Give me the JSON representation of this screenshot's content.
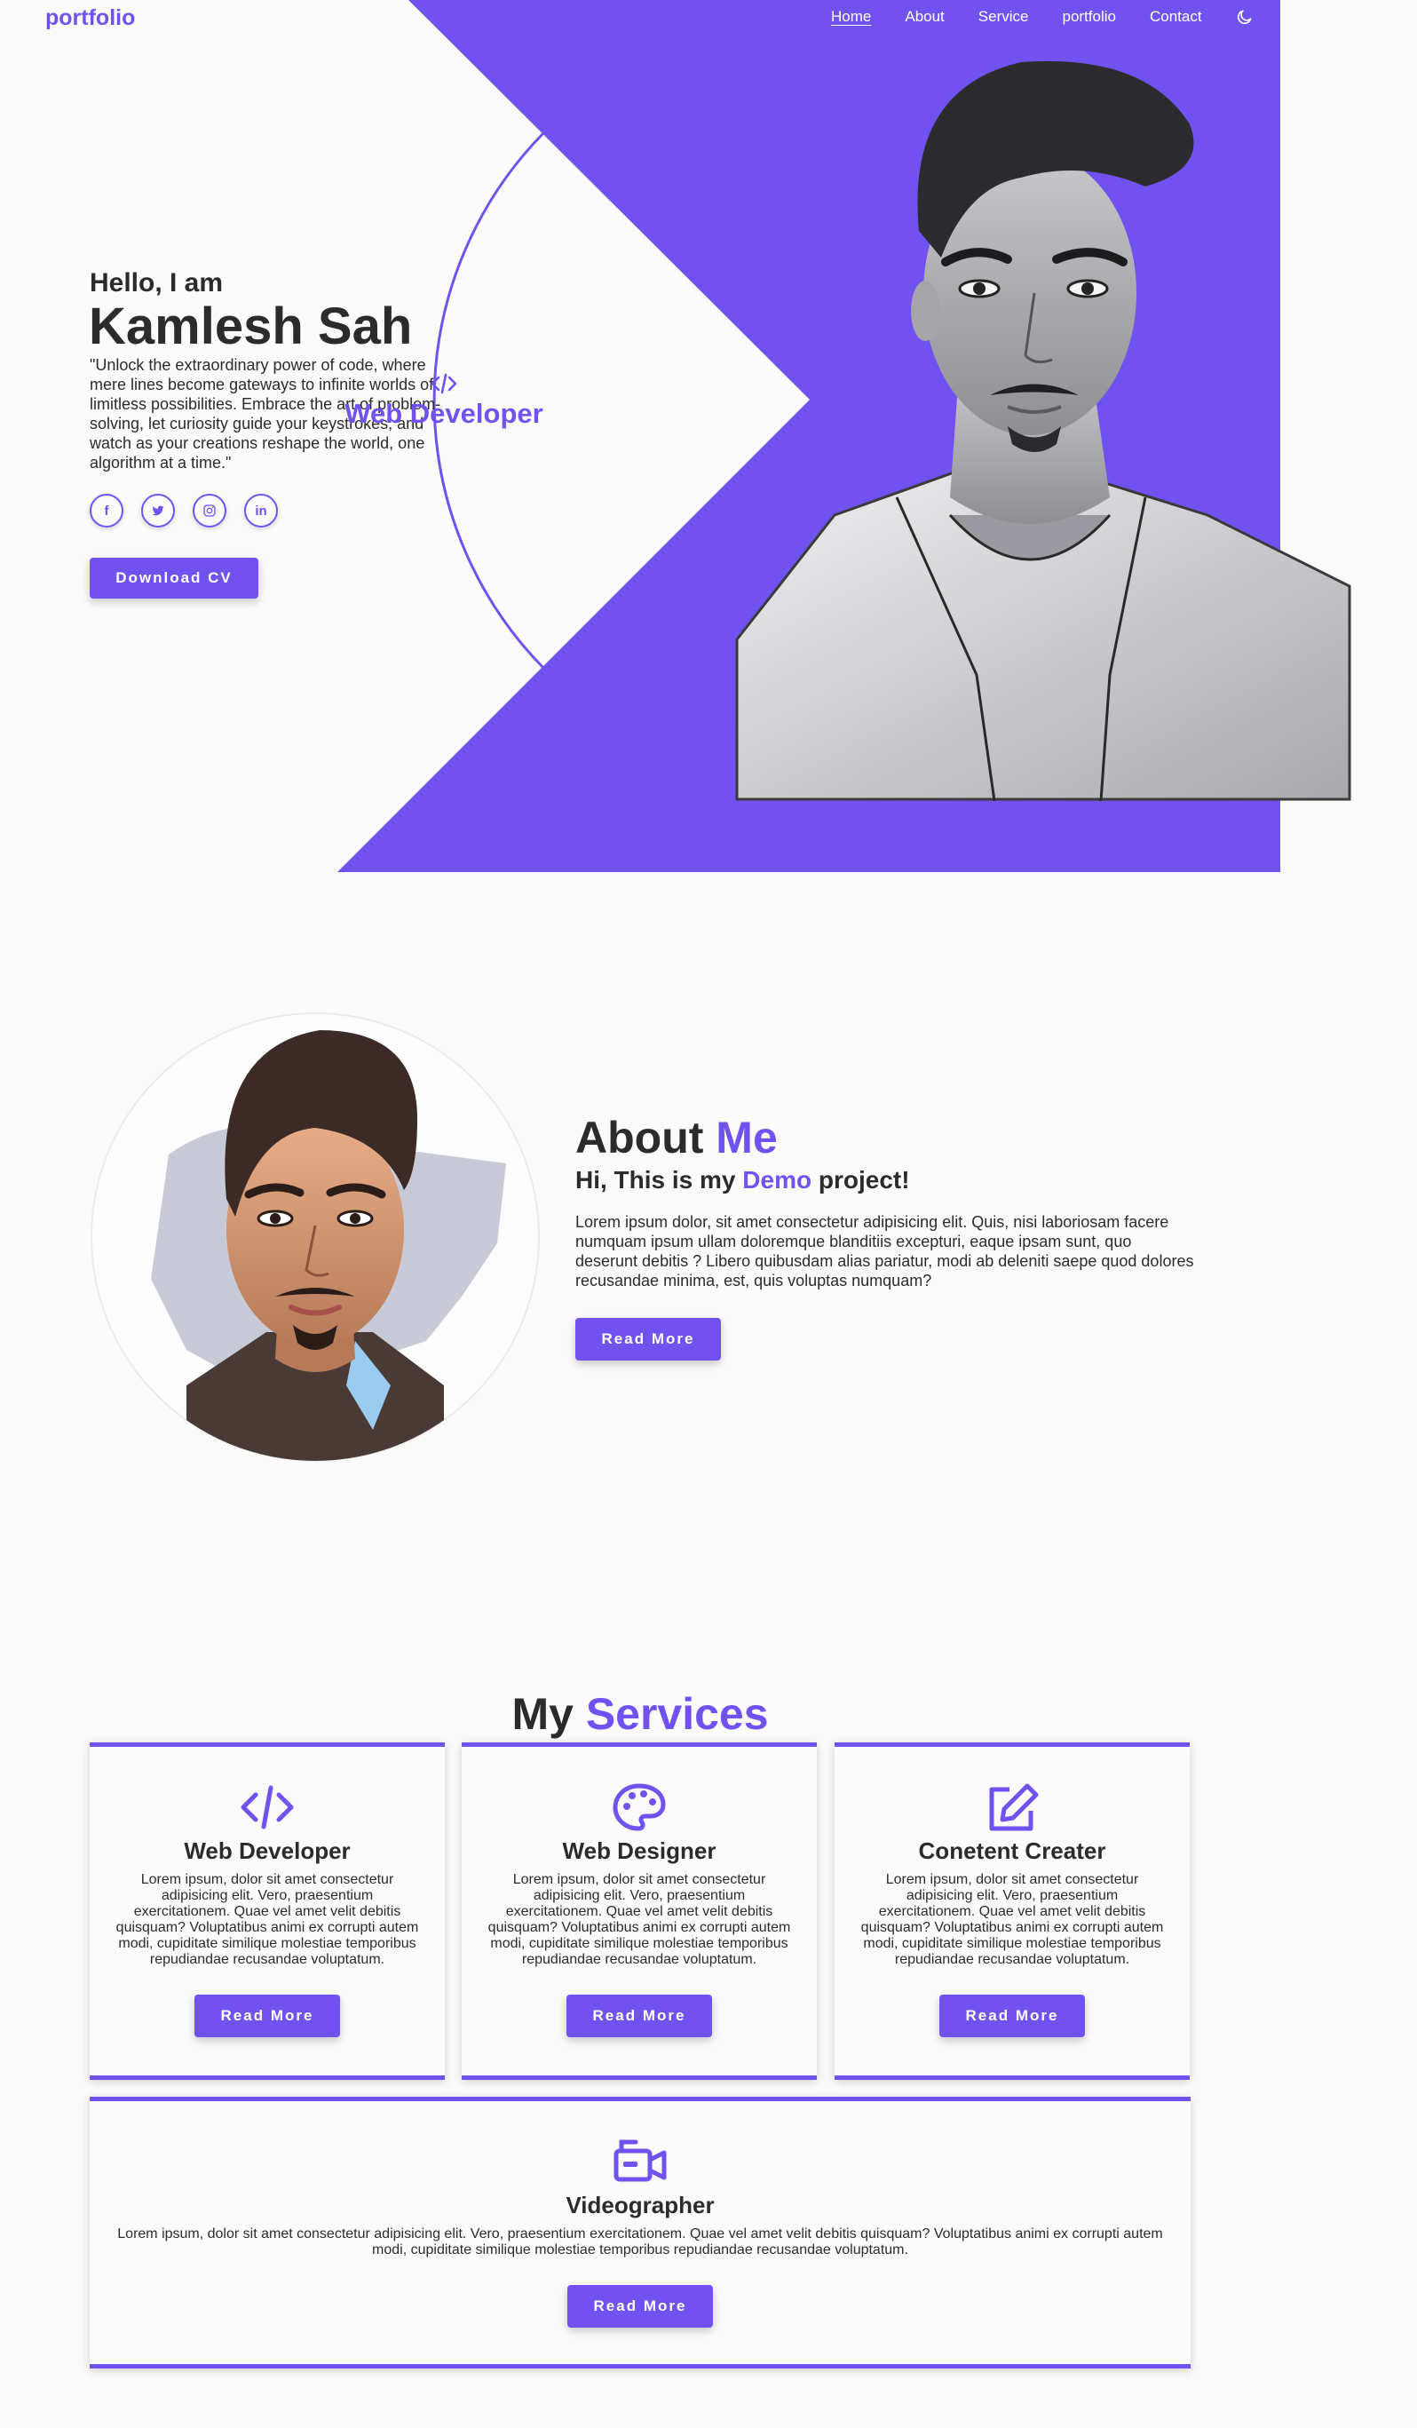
{
  "nav": {
    "logo": "portfolio",
    "links": [
      "Home",
      "About",
      "Service",
      "portfolio",
      "Contact"
    ]
  },
  "hero": {
    "greeting": "Hello, I am",
    "name": "Kamlesh Sah",
    "quote": "\"Unlock the extraordinary power of code, where mere lines become gateways to infinite worlds of limitless possibilities. Embrace the art of problem-solving, let curiosity guide your keystrokes, and watch as your creations reshape the world, one algorithm at a time.\"",
    "role": "Web Developer",
    "socials": [
      "f",
      "t",
      "ig",
      "in"
    ],
    "download_cv": "Download CV"
  },
  "about": {
    "title_main": "About",
    "title_accent": "Me",
    "sub_prefix": "Hi, This is my",
    "sub_accent": "Demo",
    "sub_suffix": "project!",
    "text": "Lorem ipsum dolor, sit amet consectetur adipisicing elit. Quis, nisi laboriosam facere numquam ipsum ullam doloremque blanditiis excepturi, eaque ipsam sunt, quo deserunt debitis ? Libero quibusdam alias pariatur, modi ab deleniti saepe quod dolores recusandae minima, est, quis voluptas numquam?",
    "read_more": "Read More"
  },
  "services": {
    "title_main": "My",
    "title_accent": "Services",
    "cards": [
      {
        "title": "Web Developer",
        "icon": "code-icon",
        "text": "Lorem ipsum, dolor sit amet consectetur adipisicing elit. Vero, praesentium exercitationem. Quae vel amet velit debitis quisquam? Voluptatibus animi ex corrupti autem modi, cupiditate similique molestiae temporibus repudiandae recusandae voluptatum.",
        "button": "Read More"
      },
      {
        "title": "Web Designer",
        "icon": "palette-icon",
        "text": "Lorem ipsum, dolor sit amet consectetur adipisicing elit. Vero, praesentium exercitationem. Quae vel amet velit debitis quisquam? Voluptatibus animi ex corrupti autem modi, cupiditate similique molestiae temporibus repudiandae recusandae voluptatum.",
        "button": "Read More"
      },
      {
        "title": "Conetent Creater",
        "icon": "edit-icon",
        "text": "Lorem ipsum, dolor sit amet consectetur adipisicing elit. Vero, praesentium exercitationem. Quae vel amet velit debitis quisquam? Voluptatibus animi ex corrupti autem modi, cupiditate similique molestiae temporibus repudiandae recusandae voluptatum.",
        "button": "Read More"
      },
      {
        "title": "Videographer",
        "icon": "video-camera-icon",
        "text": "Lorem ipsum, dolor sit amet consectetur adipisicing elit. Vero, praesentium exercitationem. Quae vel amet velit debitis quisquam? Voluptatibus animi ex corrupti autem modi, cupiditate similique molestiae temporibus repudiandae recusandae voluptatum.",
        "button": "Read More"
      }
    ]
  },
  "colors": {
    "accent": "#7152f0",
    "text": "#2b2b2b",
    "background": "#fbfbfb"
  }
}
